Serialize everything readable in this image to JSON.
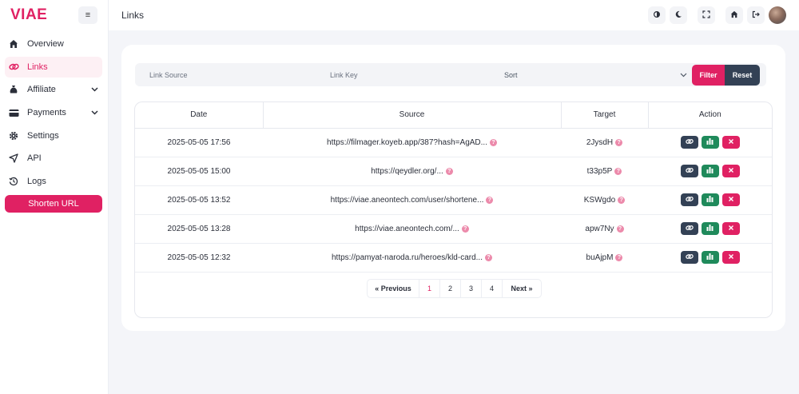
{
  "brand": {
    "logo": "VIAE",
    "accent": "#e02163"
  },
  "header": {
    "title": "Links"
  },
  "sidebar": {
    "items": [
      {
        "label": "Overview",
        "icon": "home-icon"
      },
      {
        "label": "Links",
        "icon": "link-icon"
      },
      {
        "label": "Affiliate",
        "icon": "moneybag-icon"
      },
      {
        "label": "Payments",
        "icon": "credit-card-icon"
      },
      {
        "label": "Settings",
        "icon": "gear-icon"
      },
      {
        "label": "API",
        "icon": "send-icon"
      },
      {
        "label": "Logs",
        "icon": "history-icon"
      }
    ],
    "shorten_label": "Shorten URL"
  },
  "filters": {
    "source_placeholder": "Link Source",
    "key_placeholder": "Link Key",
    "sort_value": "Sort",
    "filter_label": "Filter",
    "reset_label": "Reset"
  },
  "table": {
    "columns": [
      "Date",
      "Source",
      "Target",
      "Action"
    ],
    "rows": [
      {
        "date": "2025-05-05 17:56",
        "source": "https://filmager.koyeb.app/387?hash=AgAD...",
        "target": "2JysdH"
      },
      {
        "date": "2025-05-05 15:00",
        "source": "https://qeydler.org/...",
        "target": "t33p5P"
      },
      {
        "date": "2025-05-05 13:52",
        "source": "https://viae.aneontech.com/user/shortene...",
        "target": "KSWgdo"
      },
      {
        "date": "2025-05-05 13:28",
        "source": "https://viae.aneontech.com/...",
        "target": "apw7Ny"
      },
      {
        "date": "2025-05-05 12:32",
        "source": "https://pamyat-naroda.ru/heroes/kld-card...",
        "target": "buAjpM"
      }
    ]
  },
  "pagination": {
    "prev_label": "« Previous",
    "pages": [
      "1",
      "2",
      "3",
      "4"
    ],
    "current": "1",
    "next_label": "Next »"
  }
}
